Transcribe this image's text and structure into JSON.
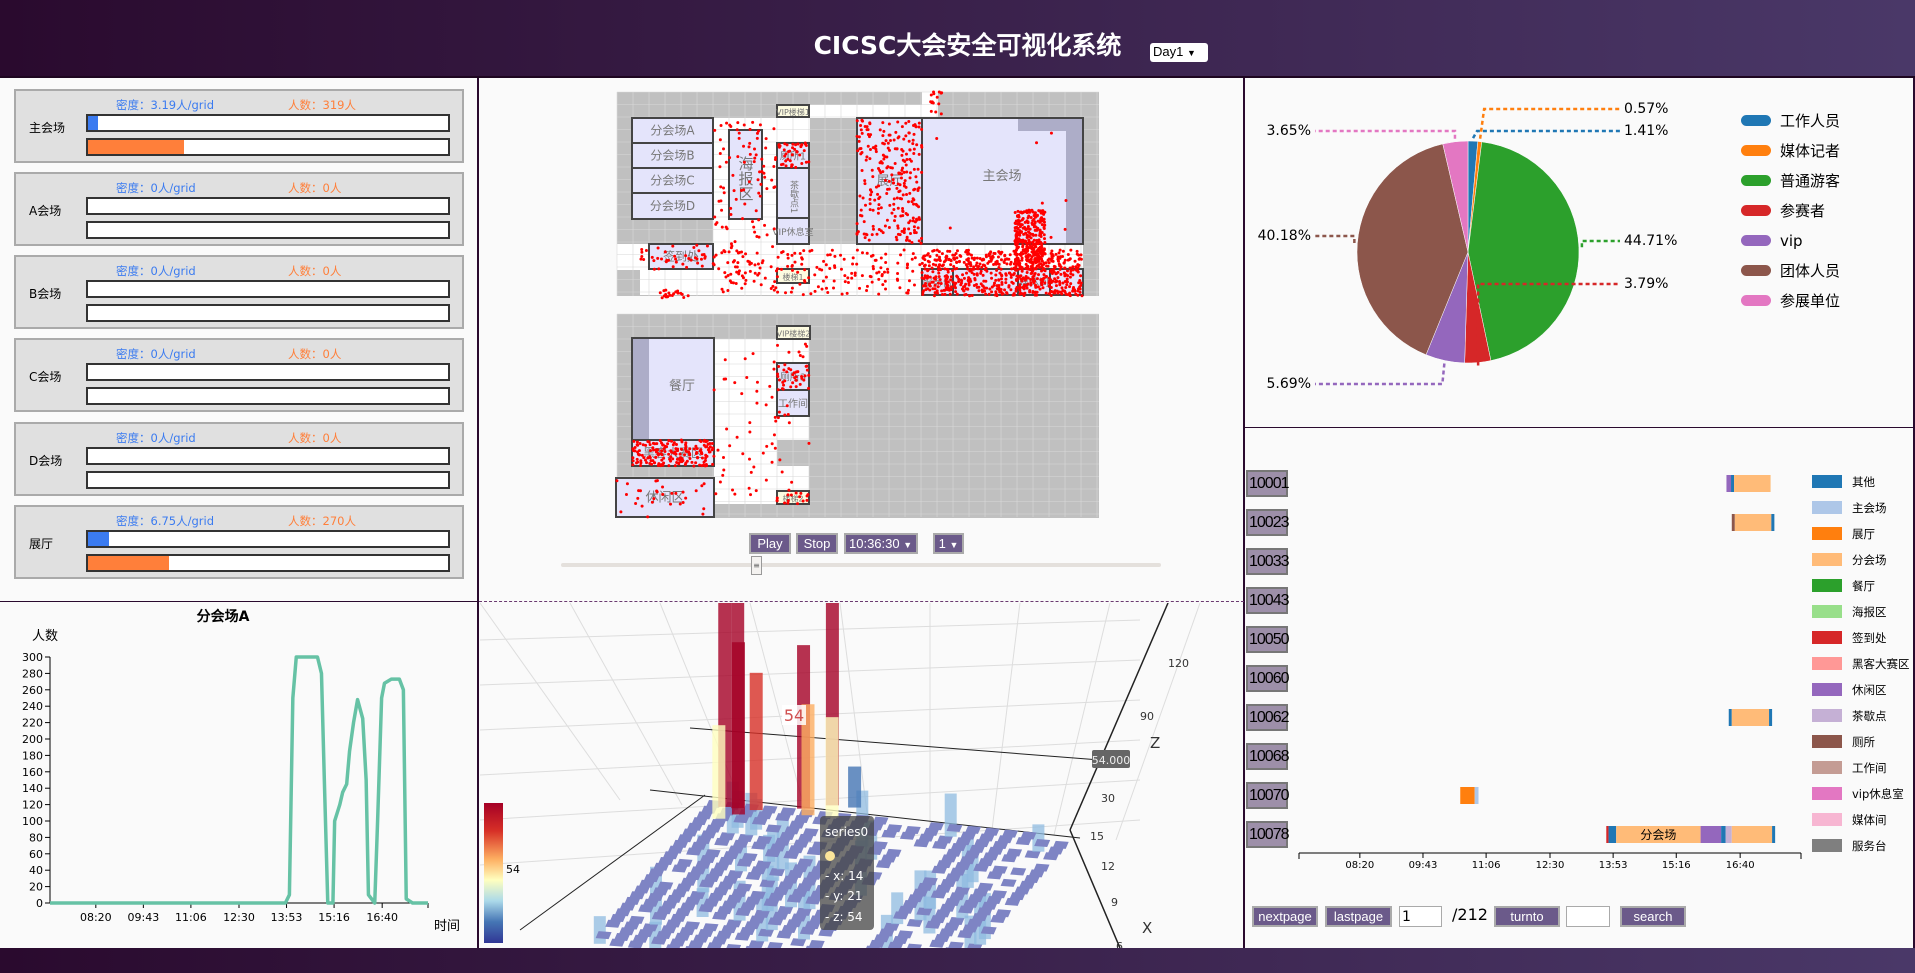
{
  "header": {
    "title": "CICSC大会安全可视化系统",
    "day_select": "Day1"
  },
  "venues": [
    {
      "name": "主会场",
      "density": "密度：3.19人/grid",
      "count": "人数：319人",
      "density_pct": 2.8,
      "count_pct": 26.6
    },
    {
      "name": "A会场",
      "density": "密度：0人/grid",
      "count": "人数：0人",
      "density_pct": 0,
      "count_pct": 0
    },
    {
      "name": "B会场",
      "density": "密度：0人/grid",
      "count": "人数：0人",
      "density_pct": 0,
      "count_pct": 0
    },
    {
      "name": "C会场",
      "density": "密度：0人/grid",
      "count": "人数：0人",
      "density_pct": 0,
      "count_pct": 0
    },
    {
      "name": "D会场",
      "density": "密度：0人/grid",
      "count": "人数：0人",
      "density_pct": 0,
      "count_pct": 0
    },
    {
      "name": "展厅",
      "density": "密度：6.75人/grid",
      "count": "人数：270人",
      "density_pct": 5.9,
      "count_pct": 22.5
    }
  ],
  "colors": {
    "density": "#3b7bf0",
    "count": "#ff7f3a",
    "line": "#66c2a5",
    "panel_border": "#2a0a2e",
    "button": "#6b5a8a"
  },
  "map": {
    "rooms_top": [
      "分会场A",
      "分会场B",
      "分会场C",
      "分会场D",
      "海报区",
      "VIP楼梯1",
      "厕所1",
      "茶歇点1",
      "VIP休息室",
      "签到处",
      "楼梯1",
      "展厅",
      "主会场",
      "服务台",
      "媒体间"
    ],
    "rooms_bottom": [
      "VIP楼梯2",
      "餐厅",
      "黑客大赛区",
      "休闲区",
      "厕所3",
      "工作间",
      "楼梯2"
    ],
    "dot_color": "#ff0000"
  },
  "controls": {
    "play": "Play",
    "stop": "Stop",
    "time": "10:36:30",
    "speed": "1",
    "slider_fraction": 0.33
  },
  "chart3d": {
    "tooltip_series": "series0",
    "tooltip_x": "- x: 14",
    "tooltip_y": "- y: 21",
    "tooltip_z": "- z: 54",
    "bar_label": "54",
    "axis_pointer": "54.000",
    "z_axis": "Z",
    "x_axis": "X",
    "z_ticks": [
      "120",
      "90",
      "30"
    ],
    "x_ticks": [
      "15",
      "12",
      "9",
      "6"
    ],
    "visualmap_value": "54"
  },
  "pagination": {
    "next": "nextpage",
    "last": "lastpage",
    "page": "1",
    "total": "/212",
    "turnto": "turnto",
    "search_value": "",
    "search": "search"
  },
  "chart_data": [
    {
      "type": "line",
      "title": "分会场A",
      "ylabel": "人数",
      "xlabel": "时间",
      "ylim": [
        0,
        300
      ],
      "yticks": [
        "0",
        "20",
        "40",
        "60",
        "80",
        "100",
        "120",
        "140",
        "160",
        "180",
        "200",
        "220",
        "240",
        "260",
        "280",
        "300"
      ],
      "xrange": [
        "07:00",
        "18:00"
      ],
      "xticks": [
        "08:20",
        "09:43",
        "11:06",
        "12:30",
        "13:53",
        "15:16",
        "16:40"
      ],
      "x": [
        "07:00",
        "13:51",
        "13:58",
        "14:04",
        "14:10",
        "14:47",
        "14:54",
        "14:59",
        "15:05",
        "15:14",
        "15:17",
        "15:26",
        "15:31",
        "15:38",
        "15:43",
        "15:50",
        "15:57",
        "16:06",
        "16:12",
        "16:16",
        "16:27",
        "16:32",
        "16:39",
        "16:44",
        "16:56",
        "17:10",
        "17:17",
        "17:22",
        "17:33",
        "18:00"
      ],
      "y": [
        0,
        0,
        10,
        250,
        300,
        300,
        280,
        150,
        0,
        0,
        100,
        120,
        135,
        145,
        185,
        220,
        248,
        225,
        150,
        10,
        0,
        100,
        250,
        268,
        273,
        273,
        260,
        5,
        0,
        0
      ]
    },
    {
      "type": "pie",
      "slices": [
        {
          "name": "工作人员",
          "value": 1.41,
          "label": "1.41%",
          "color": "#1f77b4"
        },
        {
          "name": "媒体记者",
          "value": 0.57,
          "label": "0.57%",
          "color": "#ff7f0e"
        },
        {
          "name": "普通游客",
          "value": 44.71,
          "label": "44.71%",
          "color": "#2ca02c"
        },
        {
          "name": "参赛者",
          "value": 3.79,
          "label": "3.79%",
          "color": "#d62728"
        },
        {
          "name": "vip",
          "value": 5.69,
          "label": "5.69%",
          "color": "#9467bd"
        },
        {
          "name": "团体人员",
          "value": 40.18,
          "label": "40.18%",
          "color": "#8c564b"
        },
        {
          "name": "参展单位",
          "value": 3.65,
          "label": "3.65%",
          "color": "#e377c2"
        }
      ],
      "legend": "right"
    },
    {
      "type": "gantt",
      "xrange": [
        "07:00",
        "18:00"
      ],
      "xticks": [
        "08:20",
        "09:43",
        "11:06",
        "12:30",
        "13:53",
        "15:16",
        "16:40"
      ],
      "categories": [
        {
          "name": "其他",
          "color": "#1f77b4"
        },
        {
          "name": "主会场",
          "color": "#aec7e8"
        },
        {
          "name": "展厅",
          "color": "#ff7f0e"
        },
        {
          "name": "分会场",
          "color": "#ffbb78"
        },
        {
          "name": "餐厅",
          "color": "#2ca02c"
        },
        {
          "name": "海报区",
          "color": "#98df8a"
        },
        {
          "name": "签到处",
          "color": "#d62728"
        },
        {
          "name": "黑客大赛区",
          "color": "#ff9896"
        },
        {
          "name": "休闲区",
          "color": "#9467bd"
        },
        {
          "name": "茶歇点",
          "color": "#c5b0d5"
        },
        {
          "name": "厕所",
          "color": "#8c564b"
        },
        {
          "name": "工作间",
          "color": "#c49c94"
        },
        {
          "name": "vip休息室",
          "color": "#e377c2"
        },
        {
          "name": "媒体间",
          "color": "#f7b6d2"
        },
        {
          "name": "服务台",
          "color": "#7f7f7f"
        }
      ],
      "rows": [
        {
          "id": "10001",
          "segments": [
            [
              "16:22",
              "16:28",
              "休闲区"
            ],
            [
              "16:28",
              "16:32",
              "其他"
            ],
            [
              "16:32",
              "17:20",
              "分会场"
            ]
          ]
        },
        {
          "id": "10023",
          "segments": [
            [
              "16:29",
              "16:33",
              "厕所"
            ],
            [
              "16:33",
              "17:21",
              "分会场"
            ],
            [
              "17:21",
              "17:25",
              "其他"
            ]
          ]
        },
        {
          "id": "10033",
          "segments": []
        },
        {
          "id": "10043",
          "segments": []
        },
        {
          "id": "10050",
          "segments": []
        },
        {
          "id": "10060",
          "segments": []
        },
        {
          "id": "10062",
          "segments": [
            [
              "16:25",
              "16:29",
              "其他"
            ],
            [
              "16:29",
              "17:18",
              "分会场"
            ],
            [
              "17:18",
              "17:22",
              "其他"
            ]
          ]
        },
        {
          "id": "10068",
          "segments": []
        },
        {
          "id": "10070",
          "segments": [
            [
              "10:32",
              "10:51",
              "展厅"
            ],
            [
              "10:51",
              "10:56",
              "主会场"
            ]
          ]
        },
        {
          "id": "10078",
          "segments": [
            [
              "13:44",
              "13:47",
              "签到处"
            ],
            [
              "13:47",
              "13:57",
              "其他"
            ],
            [
              "13:57",
              "15:48",
              "分会场",
              "分会场"
            ],
            [
              "15:48",
              "16:15",
              "休闲区"
            ],
            [
              "16:15",
              "16:21",
              "其他"
            ],
            [
              "16:21",
              "16:29",
              "茶歇点"
            ],
            [
              "16:29",
              "17:22",
              "分会场"
            ],
            [
              "17:22",
              "17:26",
              "其他"
            ]
          ]
        }
      ]
    }
  ]
}
